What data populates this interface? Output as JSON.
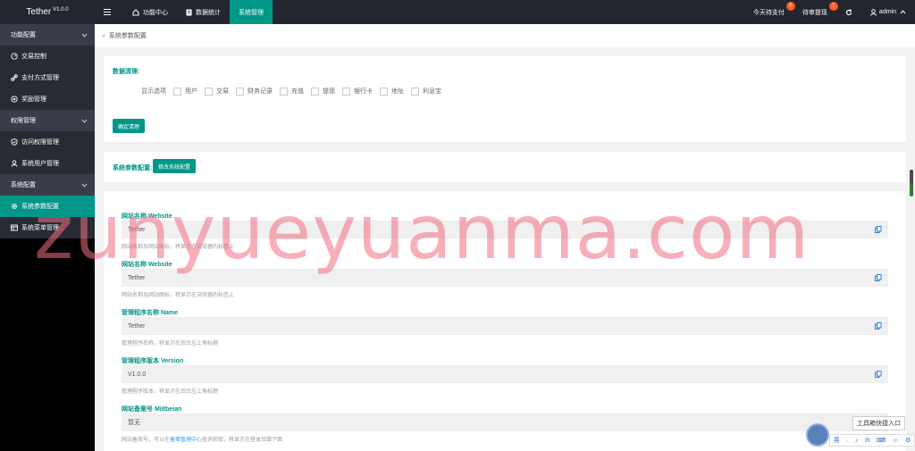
{
  "app": {
    "brand": "Tether",
    "version": "V1.0.0"
  },
  "topnav": [
    {
      "label": "功能中心",
      "icon": "house-icon",
      "active": false
    },
    {
      "label": "数据统计",
      "icon": "document-icon",
      "active": false
    },
    {
      "label": "系统管理",
      "icon": "",
      "active": true
    }
  ],
  "topright": {
    "pending_pay_label": "今天待支付",
    "pending_pay_count": "0",
    "withdraw_label": "待审提现",
    "withdraw_count": "1",
    "user_label": "admin"
  },
  "sidebar": [
    {
      "type": "group",
      "label": "功能配置"
    },
    {
      "type": "item",
      "label": "交易控制",
      "icon": "gauge-icon"
    },
    {
      "type": "item",
      "label": "支付方式管理",
      "icon": "link-icon"
    },
    {
      "type": "item",
      "label": "奖励管理",
      "icon": "target-icon"
    },
    {
      "type": "group",
      "label": "权限管理"
    },
    {
      "type": "item",
      "label": "访问权限管理",
      "icon": "shield-icon"
    },
    {
      "type": "item",
      "label": "系统用户管理",
      "icon": "user-icon"
    },
    {
      "type": "group",
      "label": "系统配置"
    },
    {
      "type": "item",
      "label": "系统参数配置",
      "icon": "gear-icon",
      "active": true
    },
    {
      "type": "item",
      "label": "系统菜单管理",
      "icon": "menu-icon"
    }
  ],
  "breadcrumb": "系统参数配置",
  "filter": {
    "title": "数据清理:",
    "show_label": "显示选项",
    "options": [
      "用户",
      "交易",
      "财务记录",
      "充值",
      "提现",
      "银行卡",
      "地址",
      "利息宝"
    ],
    "confirm_label": "确定清理"
  },
  "sysconfig": {
    "title": "系统参数配置:",
    "button_label": "修改系统配置"
  },
  "fields": [
    {
      "label": "网站名称 Website",
      "value": "Tether",
      "hint": "网站名称及网站图标，将显示在浏览器的标签上"
    },
    {
      "label": "网站名称 Website",
      "value": "Tether",
      "hint": "网站名称及网站图标，将显示在浏览器的标签上"
    },
    {
      "label": "管理程序名称 Name",
      "value": "Tether",
      "hint": "管理程序名称，将显示在后台左上角标题"
    },
    {
      "label": "管理程序版本 Version",
      "value": "V1.0.0",
      "hint": "管理程序版本，将显示在后台左上角标题"
    },
    {
      "label": "网站备案号 Miitbeian",
      "value": "暂无",
      "hint_pre": "网站备案号，可以在",
      "hint_link": "备案管理中心",
      "hint_post": "查询获取，将显示在登录页面下面"
    }
  ],
  "watermark": "zunyueyuanma.com",
  "tooltip": "工具箱快捷入口",
  "ime": [
    "英",
    "·",
    "♪",
    "✉",
    "⌨",
    "☺",
    "⚙"
  ]
}
